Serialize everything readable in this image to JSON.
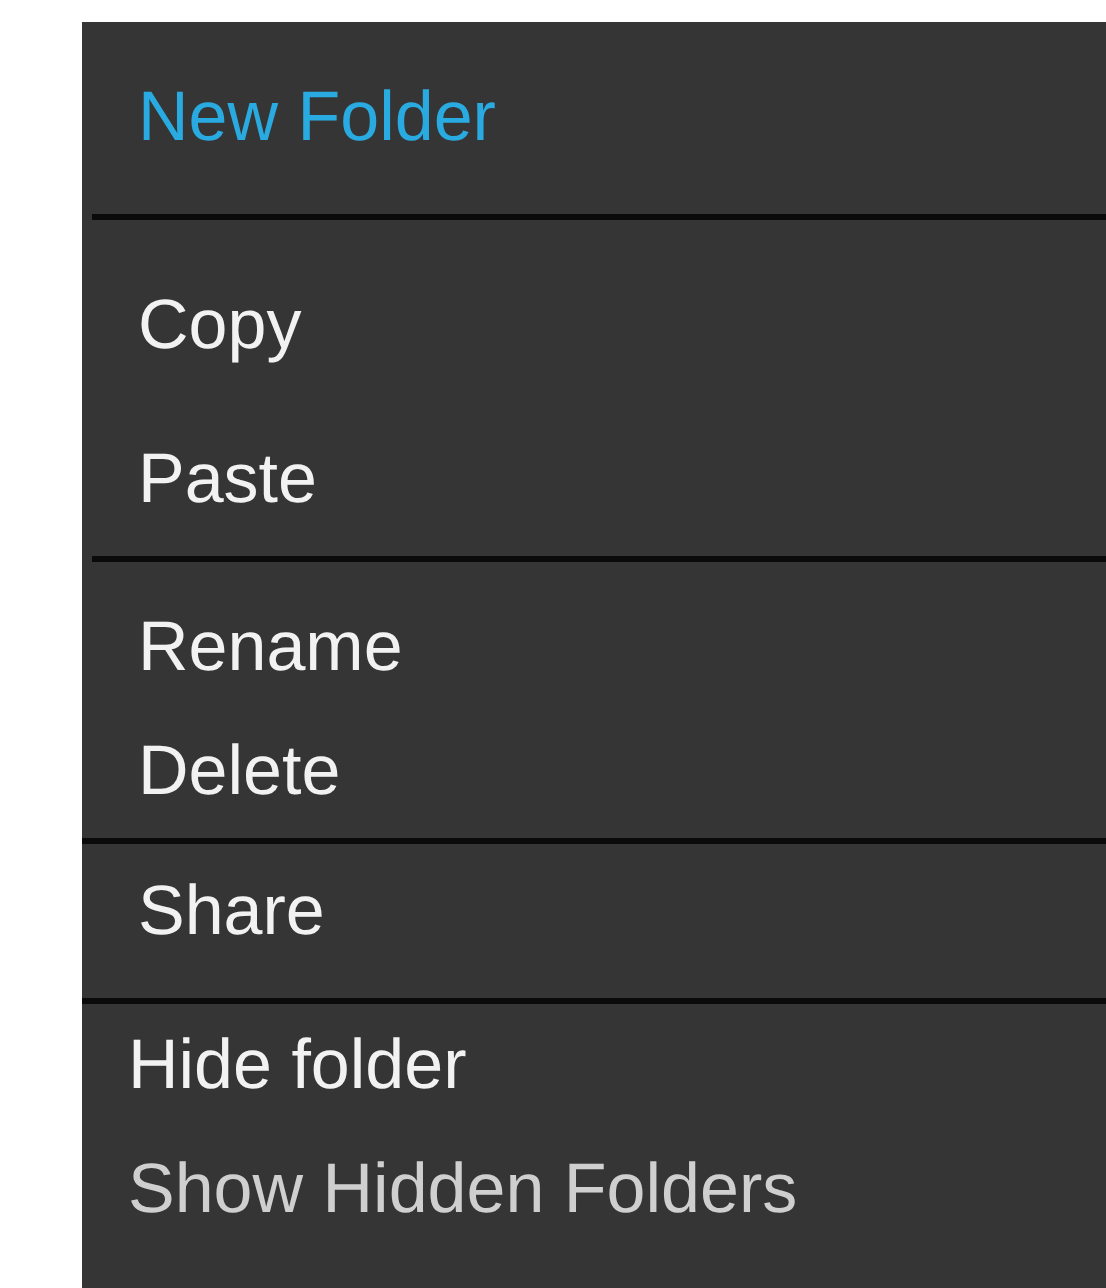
{
  "menu": {
    "groups": [
      {
        "items": [
          {
            "label": "New Folder",
            "selected": true,
            "disabled": false
          }
        ]
      },
      {
        "items": [
          {
            "label": "Copy",
            "selected": false,
            "disabled": false
          },
          {
            "label": "Paste",
            "selected": false,
            "disabled": false
          }
        ]
      },
      {
        "items": [
          {
            "label": "Rename",
            "selected": false,
            "disabled": false
          },
          {
            "label": "Delete",
            "selected": false,
            "disabled": false
          }
        ]
      },
      {
        "items": [
          {
            "label": "Share",
            "selected": false,
            "disabled": false
          }
        ]
      },
      {
        "items": [
          {
            "label": "Hide folder",
            "selected": false,
            "disabled": false
          },
          {
            "label": "Show Hidden Folders",
            "selected": false,
            "disabled": true
          }
        ]
      }
    ]
  }
}
